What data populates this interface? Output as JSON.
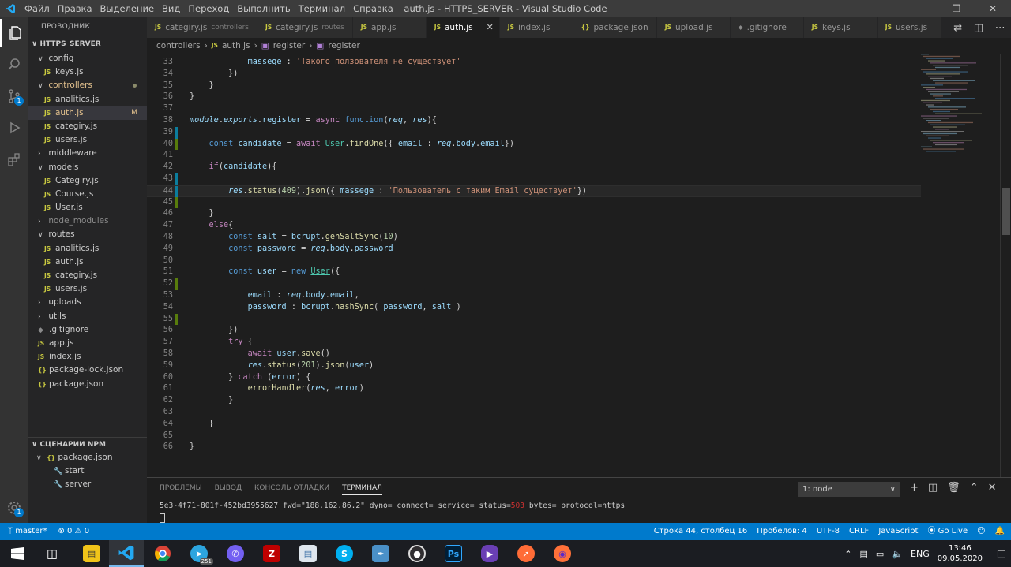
{
  "window": {
    "title": "auth.js - HTTPS_SERVER - Visual Studio Code",
    "menu": [
      "Файл",
      "Правка",
      "Выделение",
      "Вид",
      "Переход",
      "Выполнить",
      "Терминал",
      "Справка"
    ]
  },
  "sidebar": {
    "title": "ПРОВОДНИК",
    "root": "HTTPS_SERVER",
    "tree": {
      "config": "config",
      "config_keys": "keys.js",
      "controllers": "controllers",
      "c_analitics": "analitics.js",
      "c_auth": "auth.js",
      "c_auth_status": "M",
      "c_categiry": "categiry.js",
      "c_users": "users.js",
      "middleware": "middleware",
      "models": "models",
      "m_categiry": "Categiry.js",
      "m_course": "Course.js",
      "m_user": "User.js",
      "node_modules": "node_modules",
      "routes": "routes",
      "r_analitics": "analitics.js",
      "r_auth": "auth.js",
      "r_categiry": "categiry.js",
      "r_users": "users.js",
      "uploads": "uploads",
      "utils": "utils",
      "gitignore": ".gitignore",
      "app": "app.js",
      "index": "index.js",
      "package_lock": "package-lock.json",
      "package": "package.json"
    },
    "npm": {
      "title": "СЦЕНАРИИ NPM",
      "file": "package.json",
      "scripts": [
        "start",
        "server"
      ]
    },
    "js_badge": "JS",
    "json_badge": "{}"
  },
  "tabs": [
    {
      "label": "categiry.js",
      "sub": "controllers"
    },
    {
      "label": "categiry.js",
      "sub": "routes"
    },
    {
      "label": "app.js",
      "sub": ""
    },
    {
      "label": "auth.js",
      "sub": ""
    },
    {
      "label": "index.js",
      "sub": ""
    },
    {
      "label": "package.json",
      "sub": ""
    },
    {
      "label": "upload.js",
      "sub": ""
    },
    {
      "label": ".gitignore",
      "sub": ""
    },
    {
      "label": "keys.js",
      "sub": ""
    },
    {
      "label": "users.js",
      "sub": ""
    }
  ],
  "breadcrumb": {
    "folder": "controllers",
    "file": "auth.js",
    "sym1": "register",
    "sym2": "register"
  },
  "editor": {
    "language": "JavaScript",
    "current_line": 44,
    "lines": [
      {
        "n": "33",
        "code": "            massege : 'Такого ползователя не существует'"
      },
      {
        "n": "34",
        "code": "        })"
      },
      {
        "n": "35",
        "code": "    }"
      },
      {
        "n": "36",
        "code": "}"
      },
      {
        "n": "37",
        "code": ""
      },
      {
        "n": "38",
        "code": "module.exports.register = async function(req, res){"
      },
      {
        "n": "39",
        "code": ""
      },
      {
        "n": "40",
        "code": "    const candidate = await User.findOne({ email : req.body.email})"
      },
      {
        "n": "41",
        "code": ""
      },
      {
        "n": "42",
        "code": "    if(candidate){"
      },
      {
        "n": "43",
        "code": ""
      },
      {
        "n": "44",
        "code": "        res.status(409).json({ massege : 'Пользователь с таким Email существует'})"
      },
      {
        "n": "45",
        "code": ""
      },
      {
        "n": "46",
        "code": "    }"
      },
      {
        "n": "47",
        "code": "    else{"
      },
      {
        "n": "48",
        "code": "        const salt = bcrupt.genSaltSync(10)"
      },
      {
        "n": "49",
        "code": "        const password = req.body.password"
      },
      {
        "n": "50",
        "code": ""
      },
      {
        "n": "51",
        "code": "        const user = new User({"
      },
      {
        "n": "52",
        "code": ""
      },
      {
        "n": "53",
        "code": "            email : req.body.email,"
      },
      {
        "n": "54",
        "code": "            password : bcrupt.hashSync( password, salt )"
      },
      {
        "n": "55",
        "code": ""
      },
      {
        "n": "56",
        "code": "        })"
      },
      {
        "n": "57",
        "code": "        try {"
      },
      {
        "n": "58",
        "code": "            await user.save()"
      },
      {
        "n": "59",
        "code": "            res.status(201).json(user)"
      },
      {
        "n": "60",
        "code": "        } catch (error) {"
      },
      {
        "n": "61",
        "code": "            errorHandler(res, error)"
      },
      {
        "n": "62",
        "code": "        }"
      },
      {
        "n": "63",
        "code": ""
      },
      {
        "n": "64",
        "code": "    }"
      },
      {
        "n": "65",
        "code": ""
      },
      {
        "n": "66",
        "code": "}"
      }
    ]
  },
  "panel": {
    "tabs": [
      "ПРОБЛЕМЫ",
      "ВЫВОД",
      "КОНСОЛЬ ОТЛАДКИ",
      "ТЕРМИНАЛ"
    ],
    "terminal_select": "1: node",
    "terminal_text_a": "5e3-4f71-801f-452bd3955627 fwd=\"188.162.86.2\" dyno= connect= service= status=",
    "terminal_status": "503",
    "terminal_text_b": " bytes= protocol=https"
  },
  "statusbar": {
    "branch": "master*",
    "problems": "⊗ 0 ⚠ 0",
    "position": "Строка 44, столбец 16",
    "spaces": "Пробелов: 4",
    "encoding": "UTF-8",
    "eol": "CRLF",
    "language": "JavaScript",
    "golive": "Go Live"
  },
  "taskbar": {
    "telegram_badge": "251",
    "lang": "ENG",
    "time": "13:46",
    "date": "09.05.2020"
  },
  "colors": {
    "accent": "#007acc",
    "editor_bg": "#1e1e1e",
    "sidebar_bg": "#252526",
    "js_icon": "#cbcb41"
  }
}
